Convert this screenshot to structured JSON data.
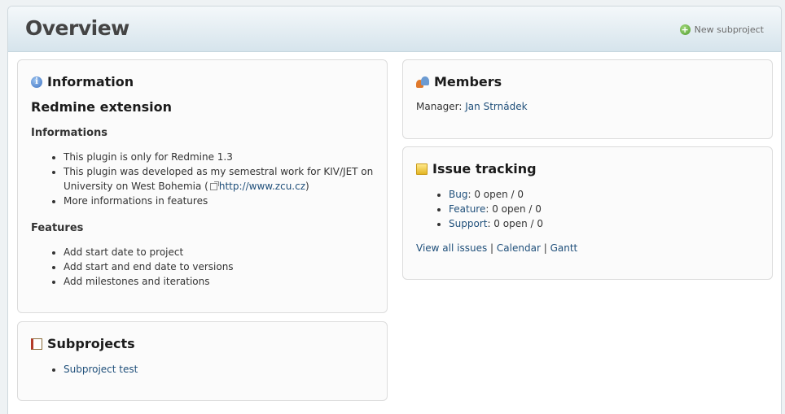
{
  "header": {
    "title": "Overview",
    "new_subproject": "New subproject"
  },
  "information": {
    "heading": "Information",
    "project_name": "Redmine extension",
    "informations_heading": "Informations",
    "info_items": [
      "This plugin is only for Redmine 1.3",
      "This plugin was developed as my semestral work for KIV/JET on University on West Bohemia (",
      "More informations in features"
    ],
    "info_link": "http://www.zcu.cz",
    "info_link_suffix": ")",
    "features_heading": "Features",
    "feature_items": [
      "Add start date to project",
      "Add start and end date to versions",
      "Add milestones and iterations"
    ]
  },
  "members": {
    "heading": "Members",
    "manager_label": "Manager:",
    "manager_name": "Jan Strnádek"
  },
  "issue_tracking": {
    "heading": "Issue tracking",
    "trackers": [
      {
        "name": "Bug",
        "counts": ": 0 open / 0"
      },
      {
        "name": "Feature",
        "counts": ": 0 open / 0"
      },
      {
        "name": "Support",
        "counts": ": 0 open / 0"
      }
    ],
    "links": {
      "view_all": "View all issues",
      "separator": "|",
      "calendar": "Calendar",
      "gantt": "Gantt"
    }
  },
  "subprojects": {
    "heading": "Subprojects",
    "items": [
      "Subproject test"
    ]
  }
}
